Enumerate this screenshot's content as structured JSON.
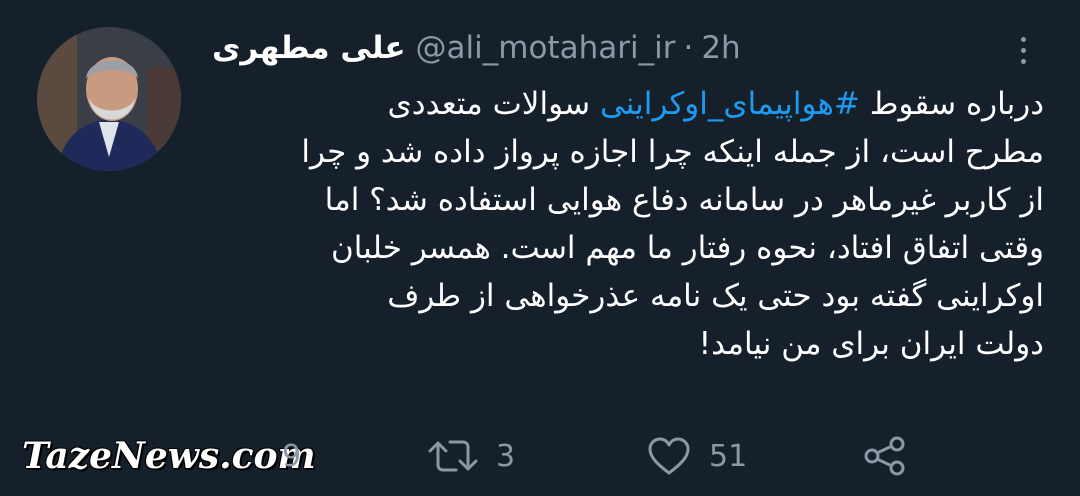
{
  "author": {
    "name": "علی مطهری",
    "handle": "@ali_motahari_ir",
    "separator": "·",
    "time": "2h"
  },
  "tweet": {
    "line1_prefix": "درباره سقوط ",
    "hashtag": "#هواپیمای_اوکراینی",
    "line1_suffix": " سوالات متعددی",
    "rest": "مطرح است، از جمله اینکه چرا اجازه پرواز داده شد و چرا\nاز کاربر غیرماهر در سامانه دفاع هوایی استفاده شد؟ اما\nوقتی اتفاق افتاد، نحوه رفتار ما مهم است. همسر خلبان\nاوکراینی گفته بود حتی یک نامه عذرخواهی از طرف\nدولت ایران برای من نیامد!"
  },
  "actions": {
    "replies": "9",
    "retweets": "3",
    "likes": "51"
  },
  "watermark": "TazeNews.com",
  "colors": {
    "background": "#15202b",
    "hashtag": "#1d9bf0",
    "muted": "#8b98a5"
  },
  "icons": [
    "menu-dots-icon",
    "reply-icon",
    "retweet-icon",
    "like-heart-icon",
    "share-icon"
  ]
}
